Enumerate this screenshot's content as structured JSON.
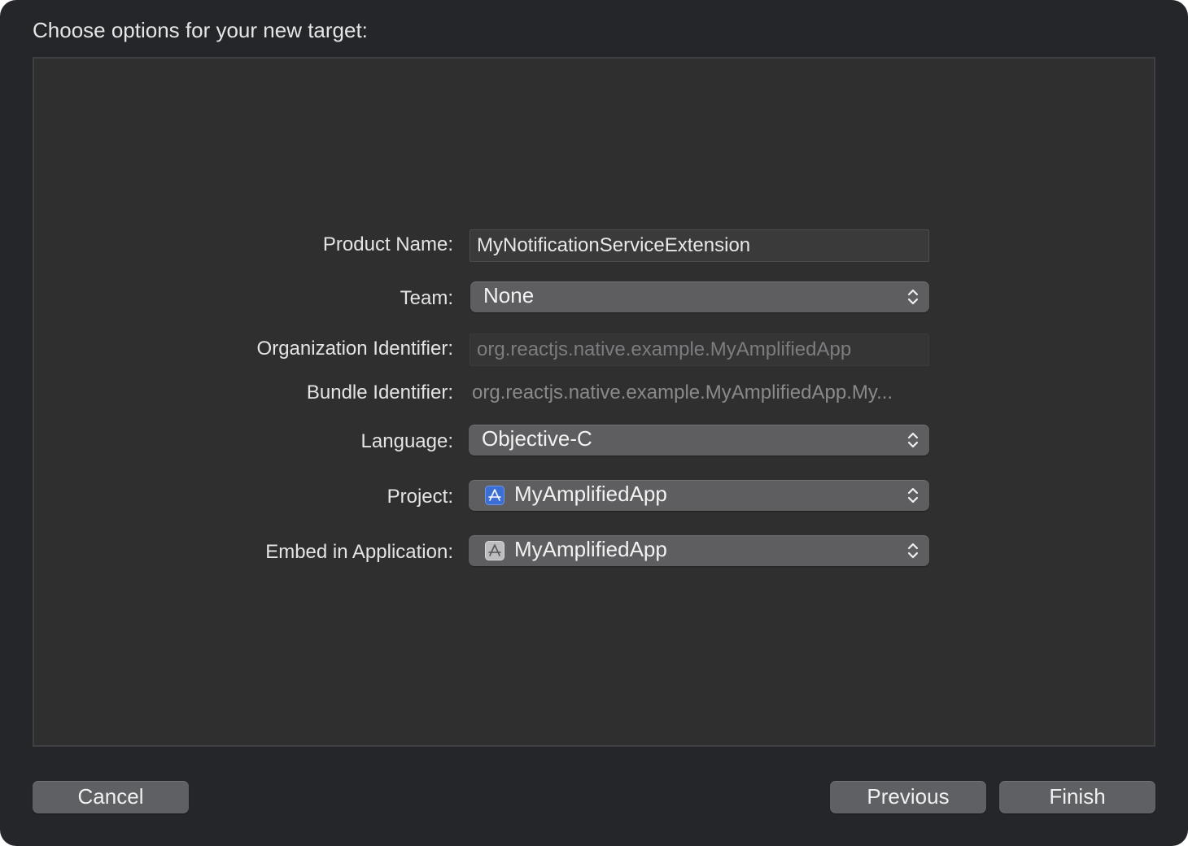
{
  "dialog": {
    "title": "Choose options for your new target:"
  },
  "form": {
    "product_name": {
      "label": "Product Name:",
      "value": "MyNotificationServiceExtension"
    },
    "team": {
      "label": "Team:",
      "value": "None"
    },
    "organization_identifier": {
      "label": "Organization Identifier:",
      "value": "org.reactjs.native.example.MyAmplifiedApp"
    },
    "bundle_identifier": {
      "label": "Bundle Identifier:",
      "value": "org.reactjs.native.example.MyAmplifiedApp.My..."
    },
    "language": {
      "label": "Language:",
      "value": "Objective-C"
    },
    "project": {
      "label": "Project:",
      "value": "MyAmplifiedApp",
      "icon": "xcode-project-icon"
    },
    "embed_in_application": {
      "label": "Embed in Application:",
      "value": "MyAmplifiedApp",
      "icon": "app-target-icon"
    }
  },
  "buttons": {
    "cancel": "Cancel",
    "previous": "Previous",
    "finish": "Finish"
  },
  "colors": {
    "dialog_background": "#24262a",
    "panel_background": "#2f2f30",
    "popup_background": "#5e5e60",
    "project_icon": "#3b6fd6"
  }
}
